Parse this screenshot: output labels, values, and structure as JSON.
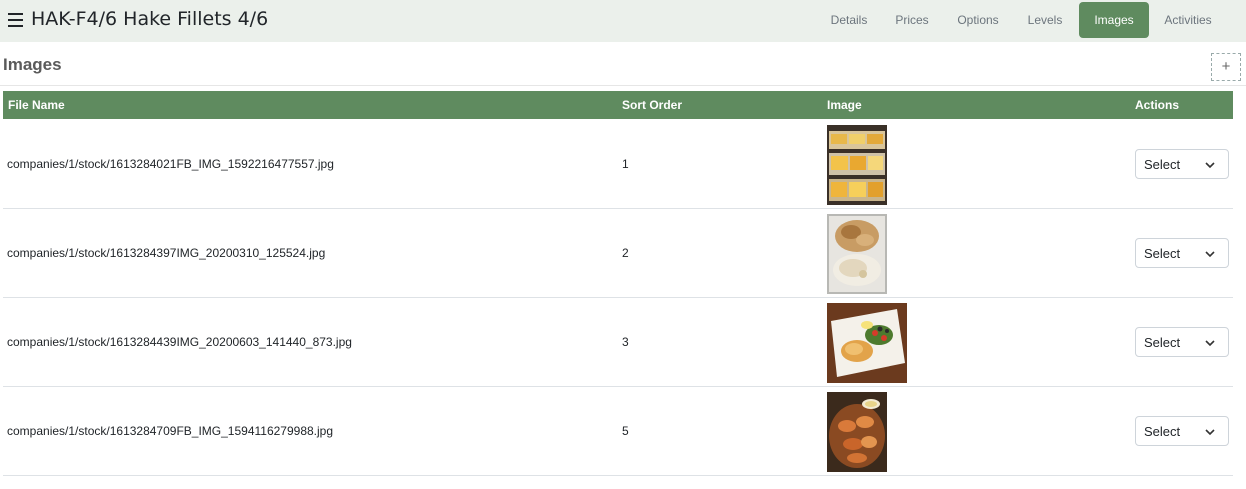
{
  "header": {
    "title": "HAK-F4/6 Hake Fillets 4/6",
    "tabs": [
      {
        "label": "Details",
        "active": false
      },
      {
        "label": "Prices",
        "active": false
      },
      {
        "label": "Options",
        "active": false
      },
      {
        "label": "Levels",
        "active": false
      },
      {
        "label": "Images",
        "active": true
      },
      {
        "label": "Activities",
        "active": false
      }
    ]
  },
  "section": {
    "title": "Images",
    "add_label": "+"
  },
  "table": {
    "columns": [
      "File Name",
      "Sort Order",
      "Image",
      "Actions"
    ],
    "rows": [
      {
        "file_name": "companies/1/stock/1613284021FB_IMG_1592216477557.jpg",
        "sort_order": "1",
        "action": "Select",
        "image": "fish-fillets-tray"
      },
      {
        "file_name": "companies/1/stock/1613284397IMG_20200310_125524.jpg",
        "sort_order": "2",
        "action": "Select",
        "image": "fried-fish-and-rice"
      },
      {
        "file_name": "companies/1/stock/1613284439IMG_20200603_141440_873.jpg",
        "sort_order": "3",
        "action": "Select",
        "image": "fish-plate-with-salad"
      },
      {
        "file_name": "companies/1/stock/1613284709FB_IMG_1594116279988.jpg",
        "sort_order": "5",
        "action": "Select",
        "image": "fried-prawns-platter"
      }
    ]
  },
  "colors": {
    "accent": "#5f8b5f",
    "header_bg": "#ebf0eb"
  }
}
